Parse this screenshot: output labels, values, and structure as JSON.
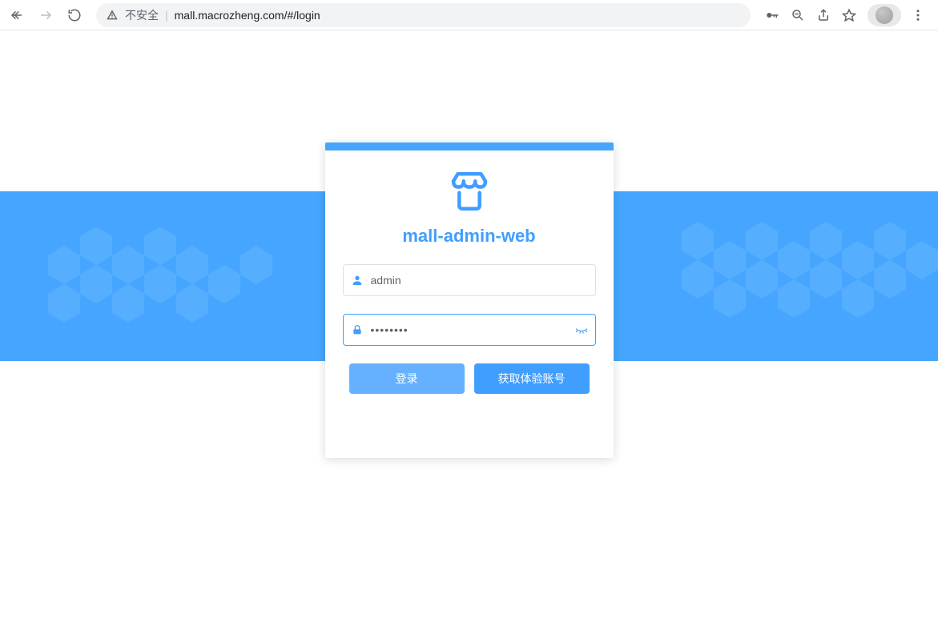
{
  "browser": {
    "not_secure_label": "不安全",
    "url": "mall.macrozheng.com/#/login"
  },
  "app": {
    "title": "mall-admin-web"
  },
  "form": {
    "username": {
      "value": "admin",
      "placeholder": ""
    },
    "password": {
      "value": "••••••••",
      "placeholder": ""
    }
  },
  "buttons": {
    "login": "登录",
    "get_trial": "获取体验账号"
  },
  "colors": {
    "accent": "#46a6ff",
    "primary": "#409eff"
  }
}
